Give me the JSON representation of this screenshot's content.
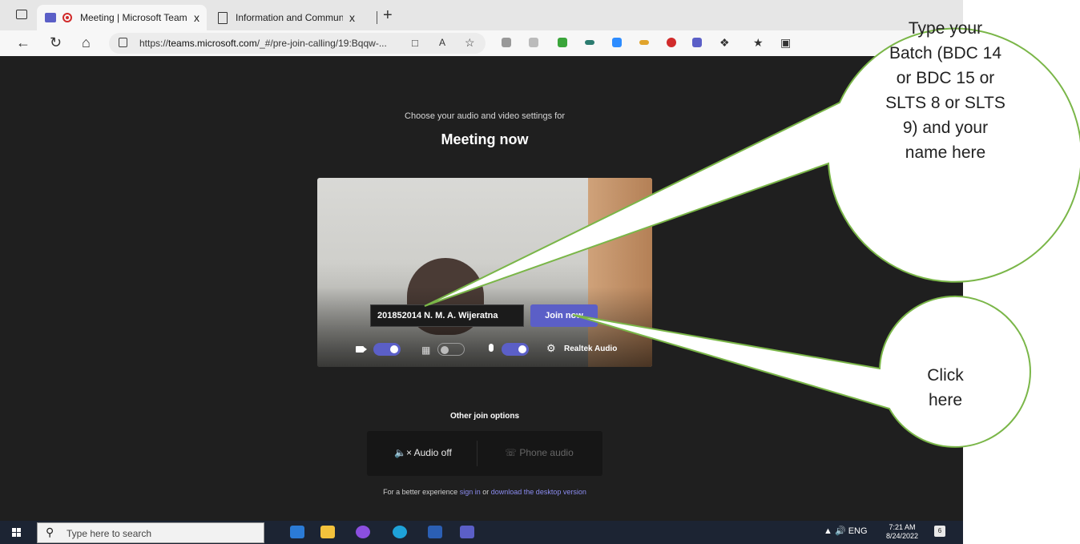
{
  "browser": {
    "tabs": [
      {
        "title": "Meeting | Microsoft Teams",
        "close": "x"
      },
      {
        "title": "Information and Communication",
        "close": "x"
      }
    ],
    "new_tab": "+",
    "url_prefix": "https://",
    "url_host": "teams.microsoft.com",
    "url_path": "/_#/pre-join-calling/19:Bqqw-..."
  },
  "prejoin": {
    "subtitle": "Choose your audio and video settings for",
    "title": "Meeting now",
    "name_value": "201852014 N. M. A. Wijeratna",
    "join_label": "Join now",
    "audio_device": "Realtek Audio",
    "camera_on": true,
    "background_blur_on": false,
    "mic_on": true
  },
  "other_options": {
    "title": "Other join options",
    "audio_off": "Audio off",
    "phone_audio": "Phone audio",
    "footer_prefix": "For a better experience",
    "sign_in": "sign in",
    "or": "or",
    "download": "download the desktop version"
  },
  "taskbar": {
    "search_placeholder": "Type here to search",
    "language": "ENG",
    "time": "7:21 AM",
    "date": "8/24/2022",
    "notifications": "6"
  },
  "callouts": {
    "top_lines": [
      "Type your",
      "Batch (BDC 14",
      "or BDC 15 or",
      "SLTS 8 or SLTS",
      "9) and your",
      "name here"
    ],
    "bottom_lines": [
      "Click",
      "here"
    ]
  },
  "colors": {
    "teams_accent": "#5b5fc7",
    "callout_border": "#7ab648",
    "dark_bg": "#1f1f1f"
  }
}
